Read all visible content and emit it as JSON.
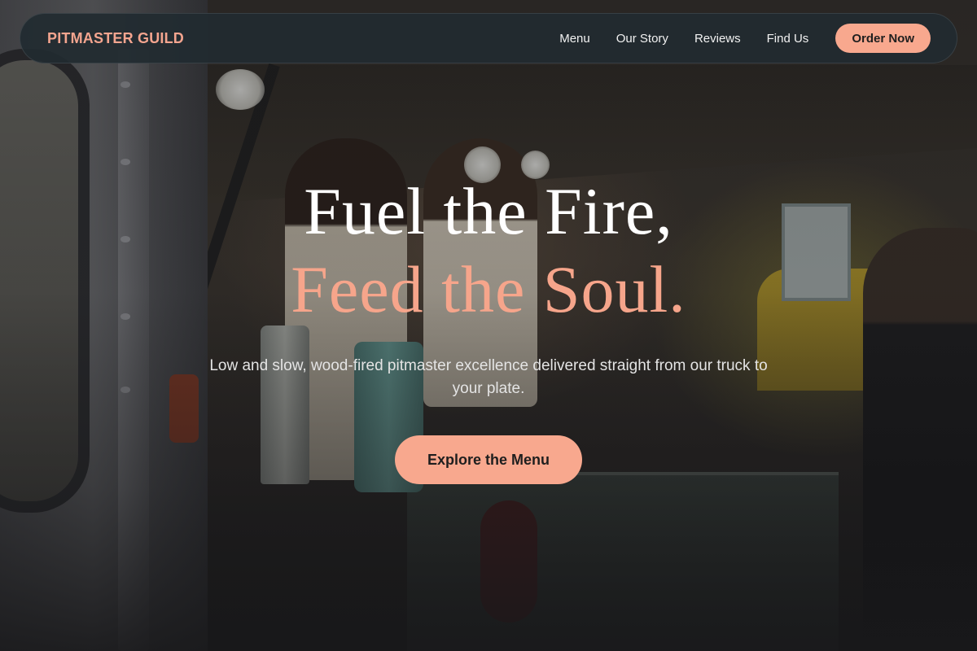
{
  "nav": {
    "brand": "PITMASTER GUILD",
    "links": [
      "Menu",
      "Our Story",
      "Reviews",
      "Find Us"
    ],
    "cta": "Order Now"
  },
  "hero": {
    "headline_line1": "Fuel the Fire,",
    "headline_line2": "Feed the Soul.",
    "subtitle": "Low and slow, wood-fired pitmaster excellence delivered straight from our truck to your plate.",
    "cta": "Explore the Menu",
    "background": "food-truck-night-photo"
  },
  "colors": {
    "accent": "#f8a88e",
    "nav_background": "#212b30",
    "text": "#ffffff"
  }
}
